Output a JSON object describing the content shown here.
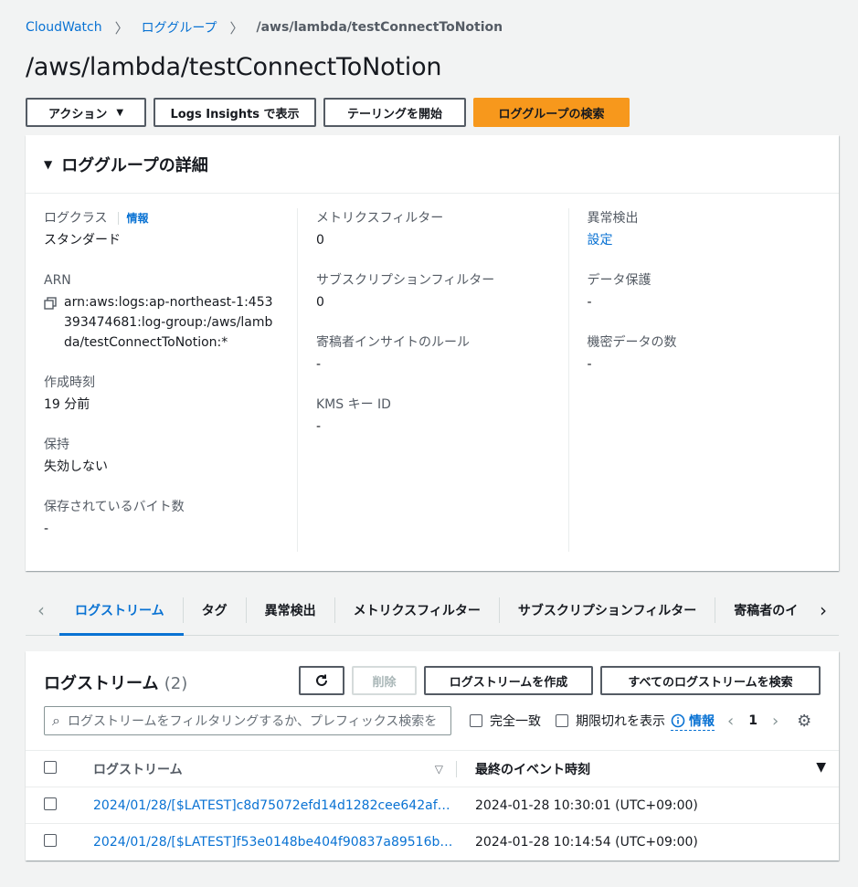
{
  "breadcrumb": {
    "root": "CloudWatch",
    "parent": "ロググループ",
    "current": "/aws/lambda/testConnectToNotion"
  },
  "page_title": "/aws/lambda/testConnectToNotion",
  "toolbar": {
    "actions": "アクション",
    "logs_insights": "Logs Insights で表示",
    "tailing": "テーリングを開始",
    "search": "ロググループの検索"
  },
  "details": {
    "header": "ロググループの詳細",
    "col1": {
      "log_class_label": "ログクラス",
      "log_class_info": "情報",
      "log_class_value": "スタンダード",
      "arn_label": "ARN",
      "arn_value": "arn:aws:logs:ap-northeast-1:453393474681:log-group:/aws/lambda/testConnectToNotion:*",
      "created_label": "作成時刻",
      "created_value": "19 分前",
      "retention_label": "保持",
      "retention_value": "失効しない",
      "stored_label": "保存されているバイト数",
      "stored_value": "-"
    },
    "col2": {
      "metric_filters_label": "メトリクスフィルター",
      "metric_filters_value": "0",
      "subscription_label": "サブスクリプションフィルター",
      "subscription_value": "0",
      "contributor_label": "寄稿者インサイトのルール",
      "contributor_value": "-",
      "kms_label": "KMS キー ID",
      "kms_value": "-"
    },
    "col3": {
      "anomaly_label": "異常検出",
      "anomaly_value": "設定",
      "data_protection_label": "データ保護",
      "data_protection_value": "-",
      "sensitive_label": "機密データの数",
      "sensitive_value": "-"
    }
  },
  "tabs": [
    "ログストリーム",
    "タグ",
    "異常検出",
    "メトリクスフィルター",
    "サブスクリプションフィルター",
    "寄稿者のイ"
  ],
  "streams": {
    "title": "ログストリーム",
    "count": "(2)",
    "delete": "削除",
    "create": "ログストリームを作成",
    "search_all": "すべてのログストリームを検索",
    "search_placeholder": "ログストリームをフィルタリングするか、プレフィックス検索を",
    "exact_match": "完全一致",
    "show_expired": "期限切れを表示",
    "info": "情報",
    "page": "1",
    "col_stream": "ログストリーム",
    "col_last_event": "最終のイベント時刻",
    "rows": [
      {
        "name": "2024/01/28/[$LATEST]c8d75072efd14d1282cee642af6…",
        "time": "2024-01-28 10:30:01 (UTC+09:00)"
      },
      {
        "name": "2024/01/28/[$LATEST]f53e0148be404f90837a89516b…",
        "time": "2024-01-28 10:14:54 (UTC+09:00)"
      }
    ]
  }
}
